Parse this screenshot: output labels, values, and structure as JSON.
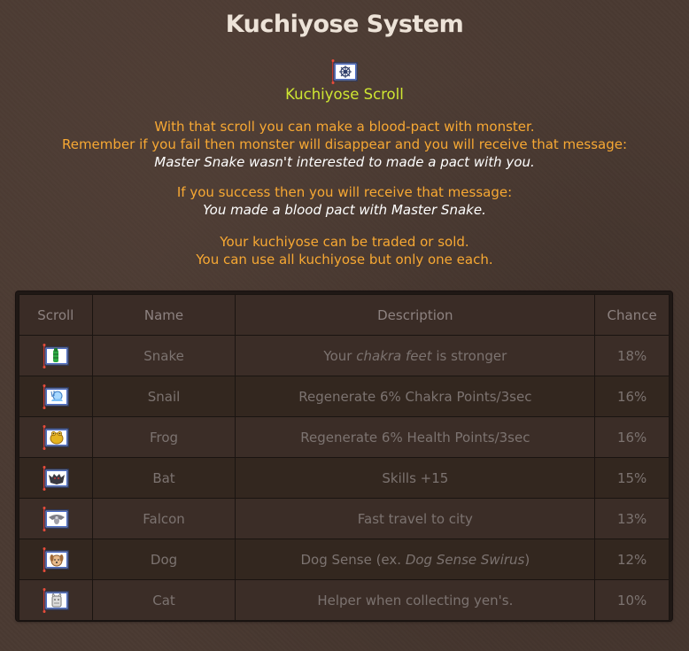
{
  "page": {
    "title": "Kuchiyose System",
    "scroll_name": "Kuchiyose Scroll",
    "scroll_icon": "kuchiyose-scroll-icon",
    "info": {
      "line1": "With that scroll you can make a blood-pact with monster.",
      "line2": "Remember if you fail then monster will disappear and you will receive that message:",
      "fail_message": "Master Snake wasn't interested to made a pact with you.",
      "line3": "If you success then you will receive that message:",
      "success_message": "You made a blood pact with Master Snake.",
      "line4": "Your kuchiyose can be traded or sold.",
      "line5": "You can use all kuchiyose but only one each."
    }
  },
  "table": {
    "headers": {
      "scroll": "Scroll",
      "name": "Name",
      "description": "Description",
      "chance": "Chance"
    },
    "rows": [
      {
        "icon": "snake-scroll-icon",
        "name": "Snake",
        "desc_pre": "Your ",
        "desc_em": "chakra feet",
        "desc_post": " is stronger",
        "chance": "18%"
      },
      {
        "icon": "snail-scroll-icon",
        "name": "Snail",
        "desc_pre": "Regenerate 6% Chakra Points/3sec",
        "desc_em": "",
        "desc_post": "",
        "chance": "16%"
      },
      {
        "icon": "frog-scroll-icon",
        "name": "Frog",
        "desc_pre": "Regenerate 6% Health Points/3sec",
        "desc_em": "",
        "desc_post": "",
        "chance": "16%"
      },
      {
        "icon": "bat-scroll-icon",
        "name": "Bat",
        "desc_pre": "Skills +15",
        "desc_em": "",
        "desc_post": "",
        "chance": "15%"
      },
      {
        "icon": "falcon-scroll-icon",
        "name": "Falcon",
        "desc_pre": "Fast travel to city",
        "desc_em": "",
        "desc_post": "",
        "chance": "13%"
      },
      {
        "icon": "dog-scroll-icon",
        "name": "Dog",
        "desc_pre": "Dog Sense (ex. ",
        "desc_em": "Dog Sense Swirus",
        "desc_post": ")",
        "chance": "12%"
      },
      {
        "icon": "cat-scroll-icon",
        "name": "Cat",
        "desc_pre": "Helper when collecting yen's.",
        "desc_em": "",
        "desc_post": "",
        "chance": "10%"
      }
    ]
  },
  "colors": {
    "background": "#4a3a32",
    "title": "#ede3d8",
    "subtitle": "#cfe632",
    "info_text": "#f7a833",
    "message_text": "#ffffff",
    "table_text": "#7c7370"
  }
}
